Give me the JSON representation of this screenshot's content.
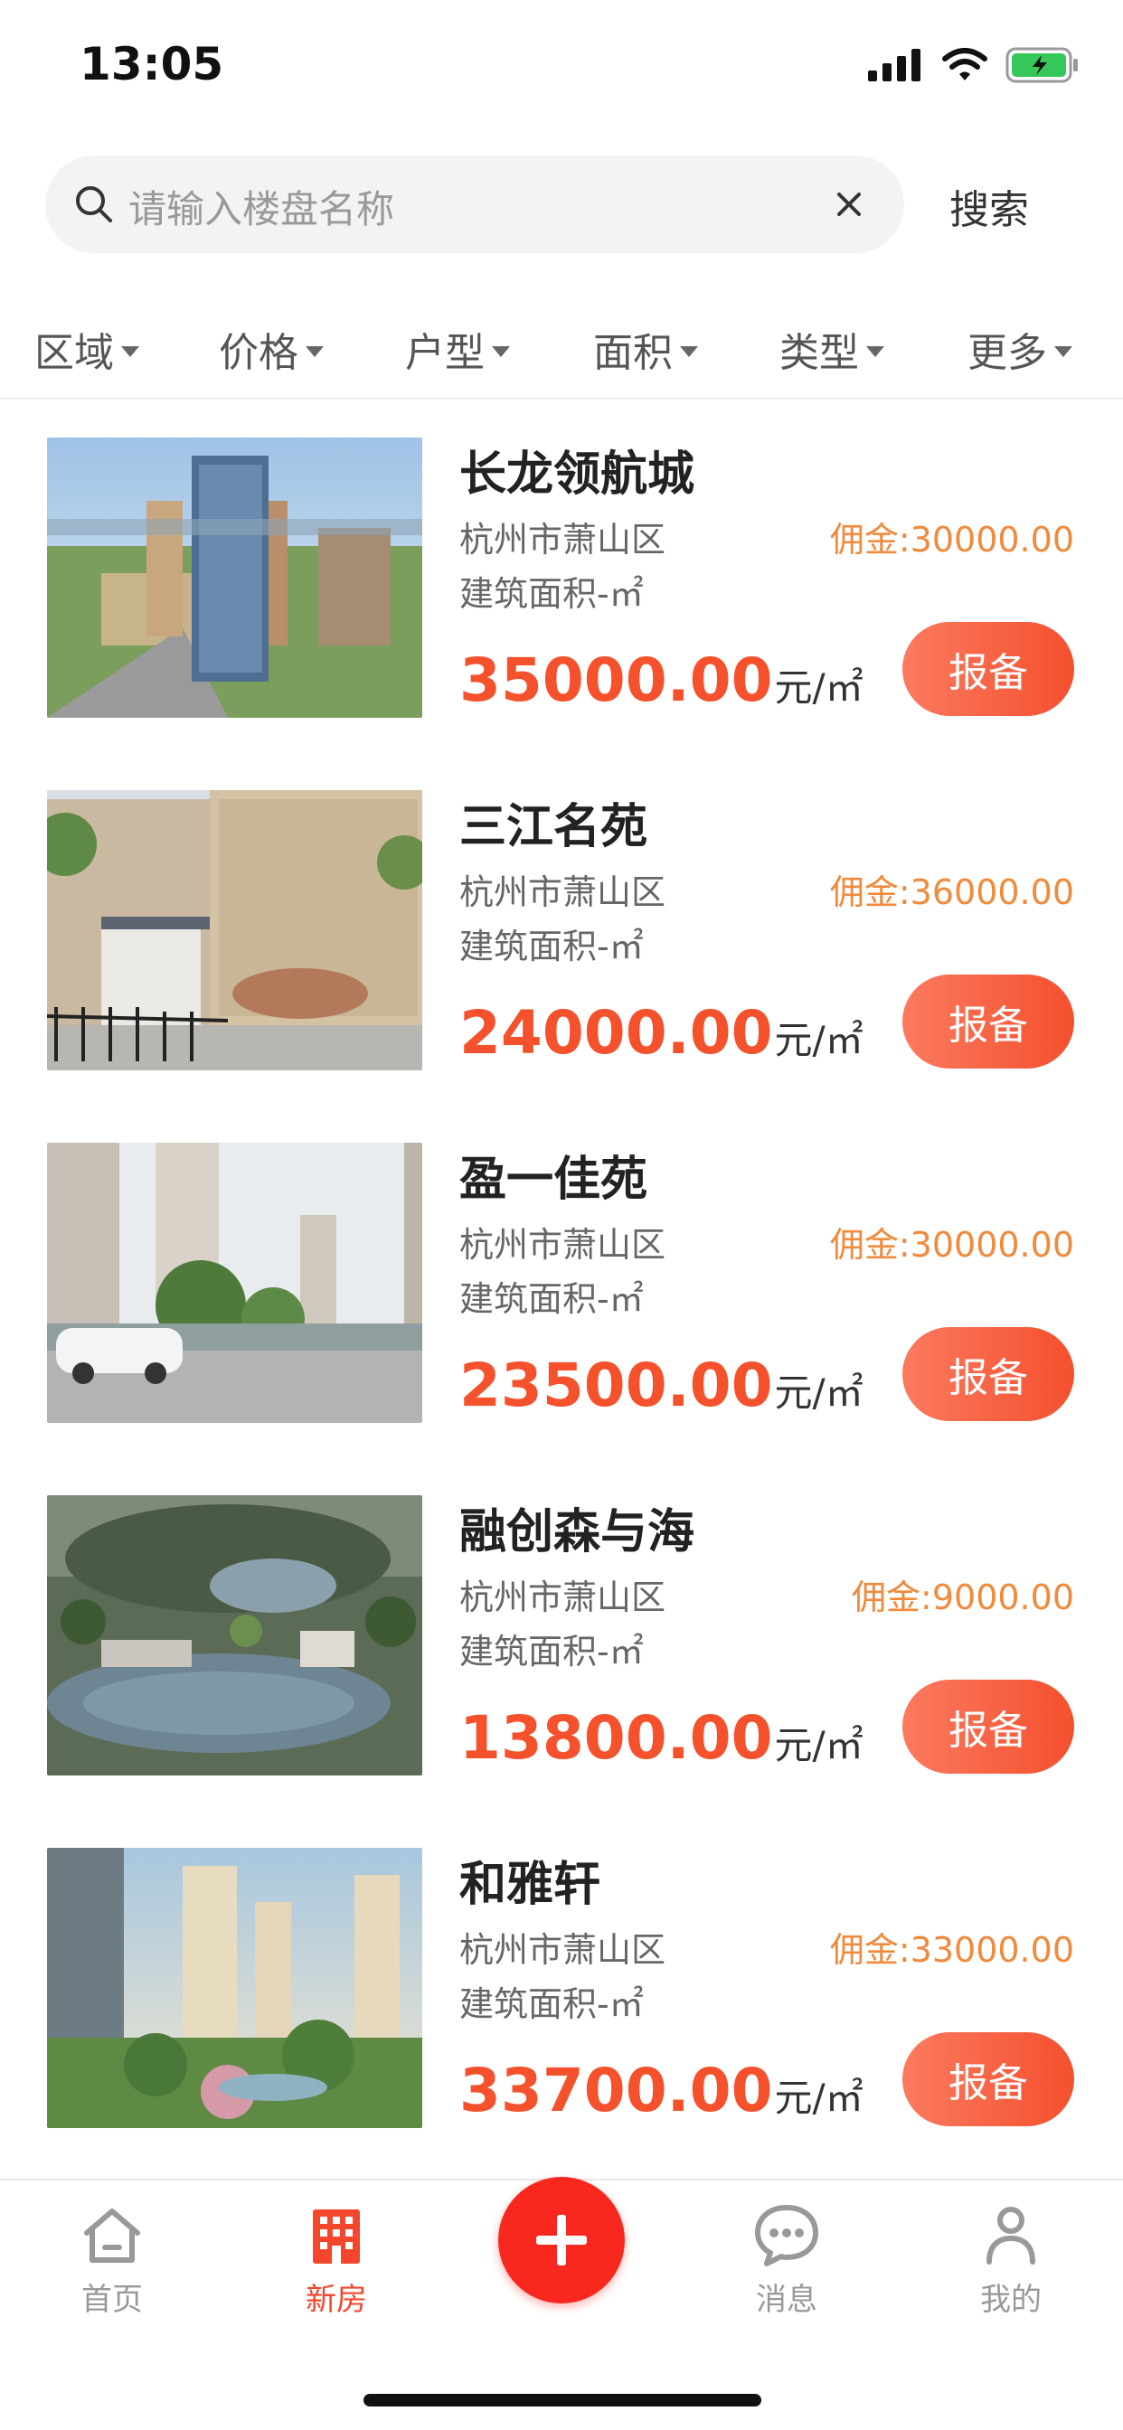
{
  "status": {
    "time": "13:05"
  },
  "search": {
    "placeholder": "请输入楼盘名称",
    "button_label": "搜索"
  },
  "filters": [
    {
      "label": "区域"
    },
    {
      "label": "价格"
    },
    {
      "label": "户型"
    },
    {
      "label": "面积"
    },
    {
      "label": "类型"
    },
    {
      "label": "更多"
    }
  ],
  "listings": [
    {
      "name": "长龙领航城",
      "area": "杭州市萧山区",
      "commission": "佣金:30000.00",
      "size": "建筑面积-㎡",
      "price": "35000.00",
      "unit": "元/㎡",
      "button": "报备"
    },
    {
      "name": "三江名苑",
      "area": "杭州市萧山区",
      "commission": "佣金:36000.00",
      "size": "建筑面积-㎡",
      "price": "24000.00",
      "unit": "元/㎡",
      "button": "报备"
    },
    {
      "name": "盈一佳苑",
      "area": "杭州市萧山区",
      "commission": "佣金:30000.00",
      "size": "建筑面积-㎡",
      "price": "23500.00",
      "unit": "元/㎡",
      "button": "报备"
    },
    {
      "name": "融创森与海",
      "area": "杭州市萧山区",
      "commission": "佣金:9000.00",
      "size": "建筑面积-㎡",
      "price": "13800.00",
      "unit": "元/㎡",
      "button": "报备"
    },
    {
      "name": "和雅轩",
      "area": "杭州市萧山区",
      "commission": "佣金:33000.00",
      "size": "建筑面积-㎡",
      "price": "33700.00",
      "unit": "元/㎡",
      "button": "报备"
    }
  ],
  "tabs": [
    {
      "label": "首页",
      "icon": "home-icon"
    },
    {
      "label": "新房",
      "icon": "building-icon",
      "active": true
    },
    {
      "label": "",
      "icon": "plus-icon"
    },
    {
      "label": "消息",
      "icon": "chat-bubble-icon"
    },
    {
      "label": "我的",
      "icon": "person-icon"
    }
  ],
  "colors": {
    "accent": "#f4512c",
    "commission": "#f08a3c",
    "plus": "#f8281f"
  }
}
